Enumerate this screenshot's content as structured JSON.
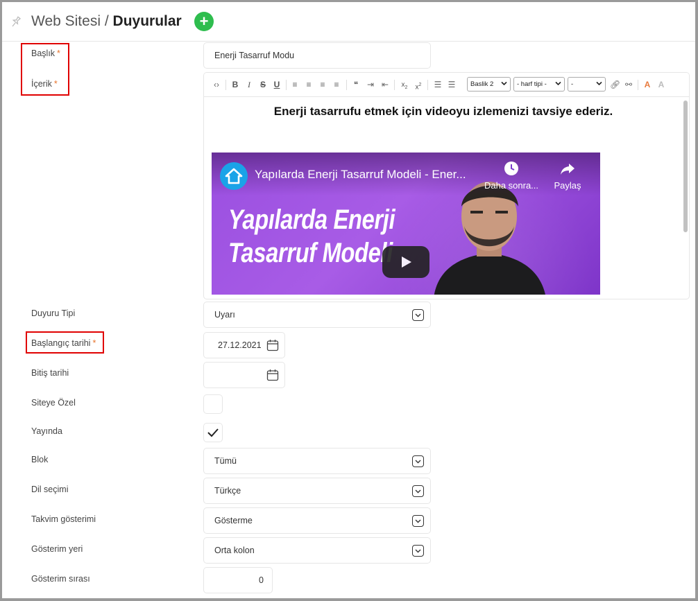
{
  "header": {
    "breadcrumb_parent": "Web Sitesi",
    "breadcrumb_sep": "/",
    "breadcrumb_current": "Duyurular",
    "add_label": "+",
    "pin_icon": "pin-icon"
  },
  "form": {
    "baslik_label": "Başlık",
    "baslik_value": "Enerji Tasarruf Modu",
    "icerik_label": "İçerik",
    "required_mark": "*",
    "duyuru_tipi_label": "Duyuru Tipi",
    "duyuru_tipi_value": "Uyarı",
    "baslangic_label": "Başlangıç tarihi",
    "baslangic_value": "27.12.2021",
    "bitis_label": "Bitiş tarihi",
    "bitis_value": "",
    "siteye_ozel_label": "Siteye Özel",
    "siteye_ozel_checked": false,
    "yayinda_label": "Yayında",
    "yayinda_checked": true,
    "blok_label": "Blok",
    "blok_value": "Tümü",
    "dil_label": "Dil seçimi",
    "dil_value": "Türkçe",
    "takvim_label": "Takvim gösterimi",
    "takvim_value": "Gösterme",
    "yeri_label": "Gösterim yeri",
    "yeri_value": "Orta kolon",
    "sira_label": "Gösterim sırası",
    "sira_value": "0"
  },
  "editor": {
    "toolbar": {
      "heading_select": "Baslik 2",
      "font_select": "- harf tipi -",
      "size_select": "-",
      "sub_label": "x",
      "sup_label": "x"
    },
    "content_heading": "Enerji tasarrufu etmek için videoyu izlemenizi tavsiye ederiz.",
    "video": {
      "title": "Yapılarda Enerji Tasarruf Modeli - Ener...",
      "watch_later": "Daha sonra...",
      "share": "Paylaş",
      "overlay_line1": "Yapılarda Enerji",
      "overlay_line2": "Tasarruf Modeli"
    }
  },
  "colors": {
    "accent_green": "#2ebd4e",
    "required_orange": "#e8742c",
    "highlight_red": "#e00000",
    "video_purple": "#9a4fe0"
  }
}
